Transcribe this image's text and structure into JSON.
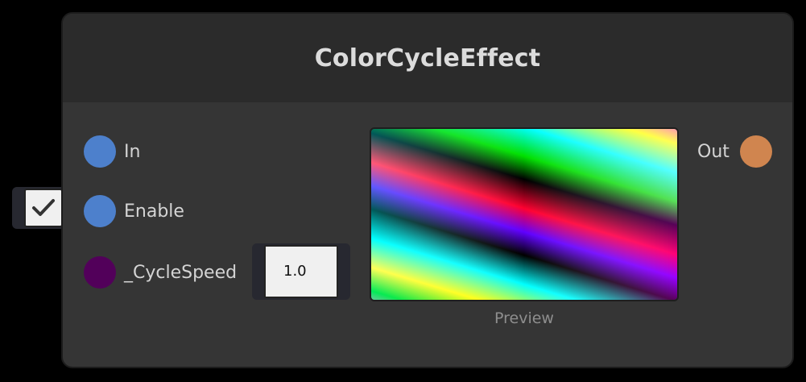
{
  "node": {
    "title": "ColorCycleEffect",
    "inputs": [
      {
        "label": "In",
        "port_color": "#4d80cc"
      },
      {
        "label": "Enable",
        "port_color": "#4d80cc",
        "enabled": true
      },
      {
        "label": "_CycleSpeed",
        "port_color": "#52005a",
        "value": "1.0"
      }
    ],
    "outputs": [
      {
        "label": "Out",
        "port_color": "#d0854f"
      }
    ],
    "preview": {
      "caption": "Preview"
    }
  },
  "colors": {
    "background": "#000000",
    "node_body": "#353535",
    "node_header": "#2b2b2b",
    "field_frame": "#272830"
  }
}
